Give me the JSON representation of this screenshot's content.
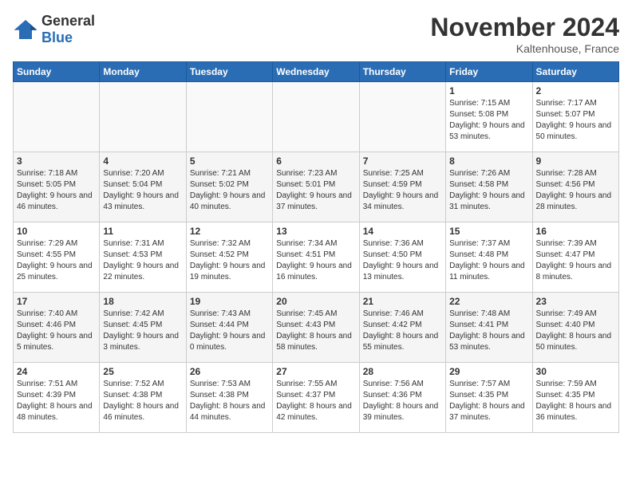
{
  "header": {
    "logo_general": "General",
    "logo_blue": "Blue",
    "month_title": "November 2024",
    "location": "Kaltenhouse, France"
  },
  "days_of_week": [
    "Sunday",
    "Monday",
    "Tuesday",
    "Wednesday",
    "Thursday",
    "Friday",
    "Saturday"
  ],
  "weeks": [
    [
      {
        "day": "",
        "info": ""
      },
      {
        "day": "",
        "info": ""
      },
      {
        "day": "",
        "info": ""
      },
      {
        "day": "",
        "info": ""
      },
      {
        "day": "",
        "info": ""
      },
      {
        "day": "1",
        "info": "Sunrise: 7:15 AM\nSunset: 5:08 PM\nDaylight: 9 hours and 53 minutes."
      },
      {
        "day": "2",
        "info": "Sunrise: 7:17 AM\nSunset: 5:07 PM\nDaylight: 9 hours and 50 minutes."
      }
    ],
    [
      {
        "day": "3",
        "info": "Sunrise: 7:18 AM\nSunset: 5:05 PM\nDaylight: 9 hours and 46 minutes."
      },
      {
        "day": "4",
        "info": "Sunrise: 7:20 AM\nSunset: 5:04 PM\nDaylight: 9 hours and 43 minutes."
      },
      {
        "day": "5",
        "info": "Sunrise: 7:21 AM\nSunset: 5:02 PM\nDaylight: 9 hours and 40 minutes."
      },
      {
        "day": "6",
        "info": "Sunrise: 7:23 AM\nSunset: 5:01 PM\nDaylight: 9 hours and 37 minutes."
      },
      {
        "day": "7",
        "info": "Sunrise: 7:25 AM\nSunset: 4:59 PM\nDaylight: 9 hours and 34 minutes."
      },
      {
        "day": "8",
        "info": "Sunrise: 7:26 AM\nSunset: 4:58 PM\nDaylight: 9 hours and 31 minutes."
      },
      {
        "day": "9",
        "info": "Sunrise: 7:28 AM\nSunset: 4:56 PM\nDaylight: 9 hours and 28 minutes."
      }
    ],
    [
      {
        "day": "10",
        "info": "Sunrise: 7:29 AM\nSunset: 4:55 PM\nDaylight: 9 hours and 25 minutes."
      },
      {
        "day": "11",
        "info": "Sunrise: 7:31 AM\nSunset: 4:53 PM\nDaylight: 9 hours and 22 minutes."
      },
      {
        "day": "12",
        "info": "Sunrise: 7:32 AM\nSunset: 4:52 PM\nDaylight: 9 hours and 19 minutes."
      },
      {
        "day": "13",
        "info": "Sunrise: 7:34 AM\nSunset: 4:51 PM\nDaylight: 9 hours and 16 minutes."
      },
      {
        "day": "14",
        "info": "Sunrise: 7:36 AM\nSunset: 4:50 PM\nDaylight: 9 hours and 13 minutes."
      },
      {
        "day": "15",
        "info": "Sunrise: 7:37 AM\nSunset: 4:48 PM\nDaylight: 9 hours and 11 minutes."
      },
      {
        "day": "16",
        "info": "Sunrise: 7:39 AM\nSunset: 4:47 PM\nDaylight: 9 hours and 8 minutes."
      }
    ],
    [
      {
        "day": "17",
        "info": "Sunrise: 7:40 AM\nSunset: 4:46 PM\nDaylight: 9 hours and 5 minutes."
      },
      {
        "day": "18",
        "info": "Sunrise: 7:42 AM\nSunset: 4:45 PM\nDaylight: 9 hours and 3 minutes."
      },
      {
        "day": "19",
        "info": "Sunrise: 7:43 AM\nSunset: 4:44 PM\nDaylight: 9 hours and 0 minutes."
      },
      {
        "day": "20",
        "info": "Sunrise: 7:45 AM\nSunset: 4:43 PM\nDaylight: 8 hours and 58 minutes."
      },
      {
        "day": "21",
        "info": "Sunrise: 7:46 AM\nSunset: 4:42 PM\nDaylight: 8 hours and 55 minutes."
      },
      {
        "day": "22",
        "info": "Sunrise: 7:48 AM\nSunset: 4:41 PM\nDaylight: 8 hours and 53 minutes."
      },
      {
        "day": "23",
        "info": "Sunrise: 7:49 AM\nSunset: 4:40 PM\nDaylight: 8 hours and 50 minutes."
      }
    ],
    [
      {
        "day": "24",
        "info": "Sunrise: 7:51 AM\nSunset: 4:39 PM\nDaylight: 8 hours and 48 minutes."
      },
      {
        "day": "25",
        "info": "Sunrise: 7:52 AM\nSunset: 4:38 PM\nDaylight: 8 hours and 46 minutes."
      },
      {
        "day": "26",
        "info": "Sunrise: 7:53 AM\nSunset: 4:38 PM\nDaylight: 8 hours and 44 minutes."
      },
      {
        "day": "27",
        "info": "Sunrise: 7:55 AM\nSunset: 4:37 PM\nDaylight: 8 hours and 42 minutes."
      },
      {
        "day": "28",
        "info": "Sunrise: 7:56 AM\nSunset: 4:36 PM\nDaylight: 8 hours and 39 minutes."
      },
      {
        "day": "29",
        "info": "Sunrise: 7:57 AM\nSunset: 4:35 PM\nDaylight: 8 hours and 37 minutes."
      },
      {
        "day": "30",
        "info": "Sunrise: 7:59 AM\nSunset: 4:35 PM\nDaylight: 8 hours and 36 minutes."
      }
    ]
  ]
}
